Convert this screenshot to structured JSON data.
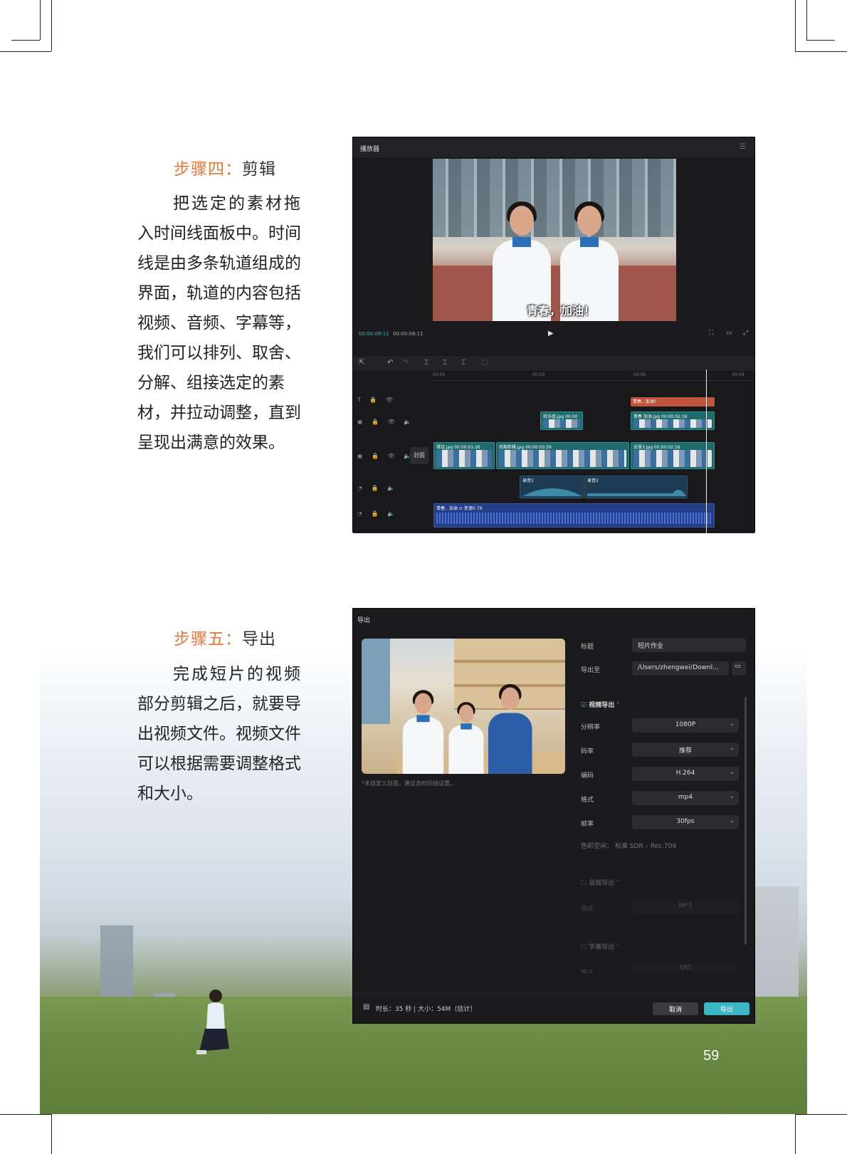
{
  "step4": {
    "label": "步骤四：",
    "title": "剪辑",
    "lines": [
      "把选定的素材拖",
      "入时间线面板中。时间",
      "线是由多条轨道组成的",
      "界面，轨道的内容包括",
      "视频、音频、字幕等，",
      "我们可以排列、取舍、",
      "分解、组接选定的素",
      "材，并拉动调整，直到",
      "呈现出满意的效果。"
    ]
  },
  "step5": {
    "label": "步骤五：",
    "title": "导出",
    "lines": [
      "完成短片的视频",
      "部分剪辑之后，就要导",
      "出视频文件。视频文件",
      "可以根据需要调整格式",
      "和大小。"
    ]
  },
  "editor": {
    "header": "播放器",
    "subtitle": "青春，加油！",
    "time_current": "00:00:08:11",
    "time_total": "00:00:08:11",
    "ruler": [
      "00:00",
      "00:03",
      "00:06",
      "00:09"
    ],
    "cover_label": "封面",
    "clips": {
      "text_clip": "青春，加油！",
      "overlay1": "欢乐组.jpg  00:00",
      "overlay2": "青春 加油.jpg  00:00:02:16",
      "main1": "得话.jpg  00:00:01:26",
      "main2": "后期剪辑.jpg  00:00:03:29",
      "main3": "安慧3.jpg  00:00:02:16",
      "audio1": "录音1",
      "audio2": "录音2",
      "music": "青春，加油  ⊙ 变速0.7X"
    }
  },
  "export": {
    "header": "导出",
    "note": "*未自定义封面，建议去时间线设置。",
    "title_label": "标题",
    "title_value": "短片作业",
    "path_label": "导出至",
    "path_value": "/Users/zhengwei/Downl...",
    "video_section": "视频导出",
    "fields": [
      {
        "label": "分辨率",
        "value": "1080P"
      },
      {
        "label": "码率",
        "value": "推荐"
      },
      {
        "label": "编码",
        "value": "H.264"
      },
      {
        "label": "格式",
        "value": "mp4"
      },
      {
        "label": "帧率",
        "value": "30fps"
      }
    ],
    "color_space": "色彩空间：  标准 SDR – Rec.709",
    "audio_section": "音频导出",
    "audio_format_label": "格式",
    "audio_format_value": "MP3",
    "subtitle_section": "字幕导出",
    "subtitle_format_label": "格式",
    "subtitle_format_value": "SRT",
    "footer_info": "时长：35 秒 | 大小：54M（估计）",
    "cancel": "取消",
    "confirm": "导出"
  },
  "page_number": "59",
  "colors": {
    "accent": "#e8773a",
    "export_button": "#3bb6c4",
    "text_clip": "#c0553f"
  }
}
